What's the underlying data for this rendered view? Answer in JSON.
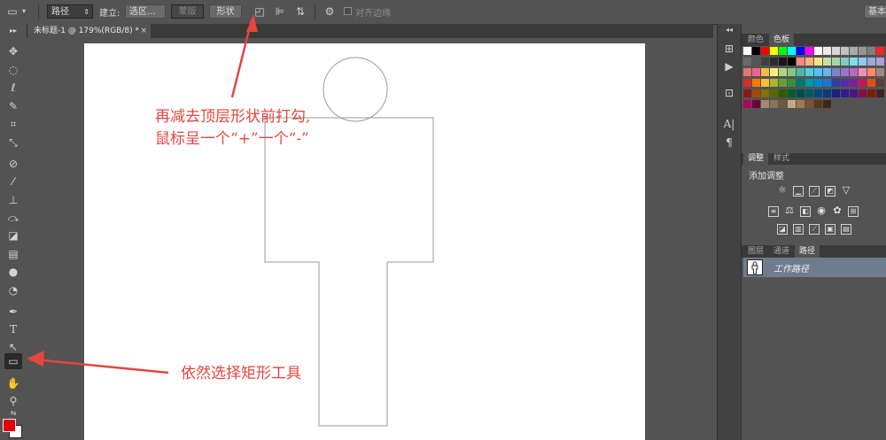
{
  "options_bar": {
    "mode_value": "路径",
    "build_label": "建立:",
    "selection_btn": "选区...",
    "mask_btn": "蒙版",
    "shape_btn": "形状",
    "align_edges_label": "对齐边缘",
    "workspace_btn": "基本"
  },
  "document": {
    "tab_title": "未标题-1 @ 179%(RGB/8) *",
    "close_glyph": "×"
  },
  "annotations": {
    "top_line1": "再减去顶层形状前打勾,",
    "top_line2": "鼠标呈一个“+”一个“-”",
    "bottom": "依然选择矩形工具",
    "color": "#e4453f"
  },
  "panels": {
    "color_tabs": [
      "颜色",
      "色板"
    ],
    "adjust_tabs": [
      "调整",
      "样式"
    ],
    "adjust_title": "添加调整",
    "layer_tabs": [
      "图层",
      "通道",
      "路径"
    ],
    "path_item": "工作路径"
  },
  "colors": {
    "foreground": "#e00000",
    "background": "#ffffff"
  }
}
